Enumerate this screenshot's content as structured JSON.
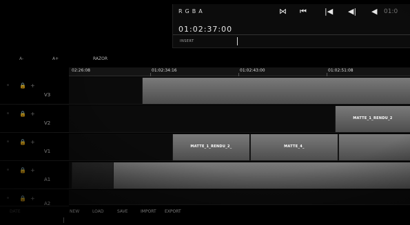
{
  "viewer": {
    "color_label": "RGBA",
    "timecode": "01:02:37:00",
    "insert_label": "INSERT",
    "partial_timecode": "01:0",
    "transport": [
      {
        "icon": "go-to-in-icon",
        "glyph": "⋈"
      },
      {
        "icon": "skip-to-start-icon",
        "glyph": "⏮"
      },
      {
        "icon": "previous-frame-icon",
        "glyph": "|◀"
      },
      {
        "icon": "step-back-icon",
        "glyph": "◀|"
      },
      {
        "icon": "play-reverse-icon",
        "glyph": "◀"
      }
    ]
  },
  "toolbar": {
    "zoom_out": "A-",
    "zoom_in": "A+",
    "razor": "RAZOR"
  },
  "ruler": {
    "ticks": [
      "02:26:08",
      "01:02:34:16",
      "01:02:43:00",
      "01:02:51:08"
    ]
  },
  "tracks": [
    {
      "name": "V3",
      "clips": [
        {
          "label": ""
        }
      ]
    },
    {
      "name": "V2",
      "clips": [
        {
          "label": "MATTE_1_RENDU_2"
        }
      ]
    },
    {
      "name": "V1",
      "clips": [
        {
          "label": "MATTE_1_RENDU_2_"
        },
        {
          "label": "MATTE_4_"
        },
        {
          "label": ""
        }
      ]
    },
    {
      "name": "A1",
      "clips": [
        {
          "label": ""
        }
      ]
    },
    {
      "name": "A2",
      "clips": []
    }
  ],
  "bottom": {
    "new": "NEW",
    "load": "LOAD",
    "save": "SAVE",
    "import": "IMPORT",
    "export": "EXPORT",
    "date_label": "DATE"
  }
}
